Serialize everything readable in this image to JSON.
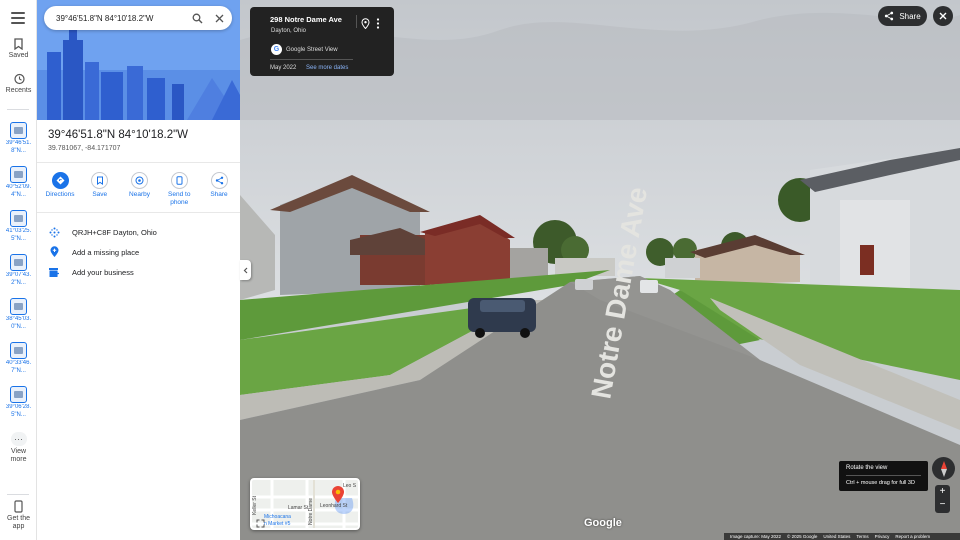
{
  "rail": {
    "saved_label": "Saved",
    "recents_label": "Recents",
    "recents": [
      {
        "label": "39°46'51.\n8\"N..."
      },
      {
        "label": "40°52'09.\n4\"N..."
      },
      {
        "label": "41°03'25.\n5\"N..."
      },
      {
        "label": "39°07'43.\n2\"N..."
      },
      {
        "label": "38°45'03.\n0\"N..."
      },
      {
        "label": "40°33'46.\n7\"N..."
      },
      {
        "label": "39°06'28.\n5\"N..."
      }
    ],
    "view_more_label": "View\nmore",
    "get_app_label": "Get the\napp"
  },
  "search": {
    "query": "39°46'51.8\"N 84°10'18.2\"W"
  },
  "place": {
    "title": "39°46'51.8\"N 84°10'18.2\"W",
    "coords": "39.781067, -84.171707"
  },
  "actions": [
    {
      "label": "Directions",
      "icon": "directions-icon"
    },
    {
      "label": "Save",
      "icon": "bookmark-icon"
    },
    {
      "label": "Nearby",
      "icon": "nearby-icon"
    },
    {
      "label": "Send to\nphone",
      "icon": "phone-icon"
    },
    {
      "label": "Share",
      "icon": "share-icon"
    }
  ],
  "rows": [
    {
      "text": "QRJH+C8F Dayton, Ohio",
      "icon": "plus-code-icon"
    },
    {
      "text": "Add a missing place",
      "icon": "add-place-icon"
    },
    {
      "text": "Add your business",
      "icon": "business-icon"
    }
  ],
  "streetview": {
    "address": "298 Notre Dame Ave",
    "city": "Dayton, Ohio",
    "source": "Google Street View",
    "date": "May 2022",
    "see_more": "See more dates",
    "share_label": "Share",
    "street_sign": "Notre Dame Ave",
    "rotate_title": "Rotate the view",
    "rotate_hint": "Ctrl + mouse drag for full 3D",
    "logo": "Google",
    "footer": [
      "Image capture: May 2022",
      "© 2025 Google",
      "United States",
      "Terms",
      "Privacy",
      "Report a problem"
    ]
  },
  "minimap": {
    "labels": [
      "Leo S",
      "Lamar St",
      "Michoacana",
      "Leonhard St",
      "n Market #5",
      "Keller St",
      "Notre Dame"
    ]
  },
  "colors": {
    "accent": "#1a73e8",
    "dark_ui": "#222222",
    "hero": "#6fa2f0"
  }
}
